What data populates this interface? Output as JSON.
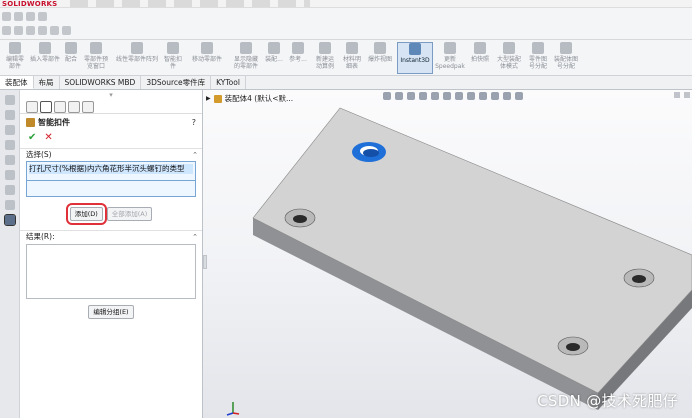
{
  "app": {
    "logo": "SOLIDWORKS"
  },
  "ribbon": {
    "items": [
      {
        "label": "编辑零\n部件"
      },
      {
        "label": "插入零部件"
      },
      {
        "label": "配合"
      },
      {
        "label": "零部件预\n览窗口"
      },
      {
        "label": "线性零部件阵列"
      },
      {
        "label": "智能扣\n件"
      },
      {
        "label": "移动零部件"
      },
      {
        "label": "显示隐藏\n的零部件"
      },
      {
        "label": "装配..."
      },
      {
        "label": "参考..."
      },
      {
        "label": "新建运\n动算例"
      },
      {
        "label": "材料明\n细表"
      },
      {
        "label": "爆炸视图"
      },
      {
        "label": "Instant3D"
      },
      {
        "label": "更新\nSpeedpak"
      },
      {
        "label": "拍快照"
      },
      {
        "label": "大型装配\n体模式"
      },
      {
        "label": "零件图\n号分配"
      },
      {
        "label": "装配体图\n号分配"
      }
    ]
  },
  "tabs": [
    {
      "label": "装配体",
      "active": true
    },
    {
      "label": "布局"
    },
    {
      "label": "SOLIDWORKS MBD"
    },
    {
      "label": "3DSource零件库"
    },
    {
      "label": "KYTool"
    }
  ],
  "property_manager": {
    "title": "智能扣件",
    "help": "?",
    "ok": "✔",
    "cancel": "✕",
    "selection": {
      "header": "选择(S)",
      "item": "打孔尺寸(%根据)内六角花形半沉头螺钉的类型"
    },
    "buttons": {
      "add": "添加(D)",
      "populate_all": "全部添加(A)"
    },
    "results": {
      "header": "结果(R):"
    },
    "edit_group": "编辑分组(E)"
  },
  "viewport": {
    "tree_label": "装配体4 (默认<默...",
    "watermark": "CSDN @技术死肥仔"
  },
  "colors": {
    "part_top": "#d3d3d3",
    "part_side": "#8f9194",
    "highlight_hole": "#1f6fd8",
    "annotation_red": "#e0303a"
  }
}
